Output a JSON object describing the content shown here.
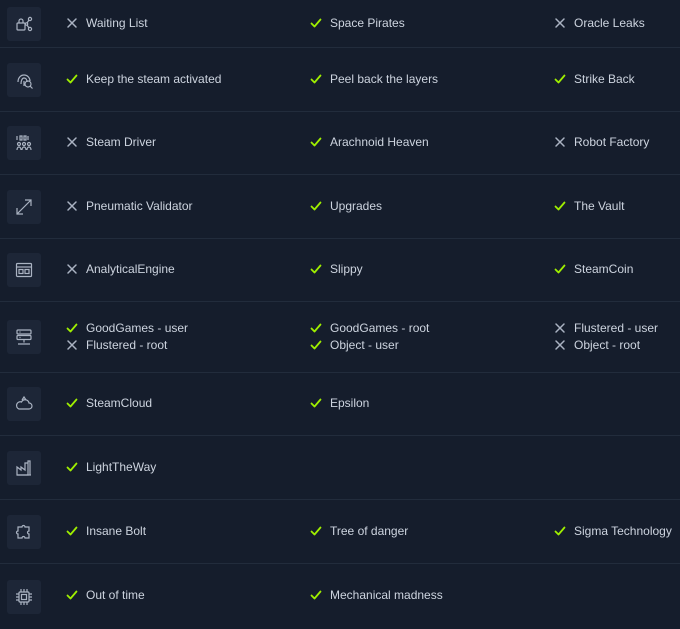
{
  "colors": {
    "background": "#151d2c",
    "icon_bg": "#1d2637",
    "check": "#9fef00",
    "cross": "#aab3c2",
    "divider": "#222c3c",
    "text": "#cdd4df"
  },
  "rows": [
    {
      "icon": "lock-share-icon",
      "columns": [
        [
          {
            "label": "Waiting List",
            "done": false
          }
        ],
        [
          {
            "label": "Space Pirates",
            "done": true
          }
        ],
        [
          {
            "label": "Oracle Leaks",
            "done": false
          }
        ]
      ]
    },
    {
      "icon": "fingerprint-search-icon",
      "columns": [
        [
          {
            "label": "Keep the steam activated",
            "done": true
          }
        ],
        [
          {
            "label": "Peel back the layers",
            "done": true
          }
        ],
        [
          {
            "label": "Strike Back",
            "done": true
          }
        ]
      ]
    },
    {
      "icon": "binary-code-icon",
      "columns": [
        [
          {
            "label": "Steam Driver",
            "done": false
          }
        ],
        [
          {
            "label": "Arachnoid Heaven",
            "done": true
          }
        ],
        [
          {
            "label": "Robot Factory",
            "done": false
          }
        ]
      ]
    },
    {
      "icon": "diagonal-arrows-icon",
      "columns": [
        [
          {
            "label": "Pneumatic Validator",
            "done": false
          }
        ],
        [
          {
            "label": "Upgrades",
            "done": true
          }
        ],
        [
          {
            "label": "The Vault",
            "done": true
          }
        ]
      ]
    },
    {
      "icon": "window-app-icon",
      "columns": [
        [
          {
            "label": "AnalyticalEngine",
            "done": false
          }
        ],
        [
          {
            "label": "Slippy",
            "done": true
          }
        ],
        [
          {
            "label": "SteamCoin",
            "done": true
          }
        ]
      ]
    },
    {
      "icon": "server-network-icon",
      "columns": [
        [
          {
            "label": "GoodGames - user",
            "done": true
          },
          {
            "label": "Flustered - root",
            "done": false
          }
        ],
        [
          {
            "label": "GoodGames - root",
            "done": true
          },
          {
            "label": "Object - user",
            "done": true
          }
        ],
        [
          {
            "label": "Flustered - user",
            "done": false
          },
          {
            "label": "Object - root",
            "done": false
          }
        ]
      ]
    },
    {
      "icon": "cloud-icon",
      "columns": [
        [
          {
            "label": "SteamCloud",
            "done": true
          }
        ],
        [
          {
            "label": "Epsilon",
            "done": true
          }
        ],
        []
      ]
    },
    {
      "icon": "factory-icon",
      "columns": [
        [
          {
            "label": "LightTheWay",
            "done": true
          }
        ],
        [],
        []
      ]
    },
    {
      "icon": "puzzle-icon",
      "columns": [
        [
          {
            "label": "Insane Bolt",
            "done": true
          }
        ],
        [
          {
            "label": "Tree of danger",
            "done": true
          }
        ],
        [
          {
            "label": "Sigma Technology",
            "done": true
          }
        ]
      ]
    },
    {
      "icon": "chip-icon",
      "columns": [
        [
          {
            "label": "Out of time",
            "done": true
          }
        ],
        [
          {
            "label": "Mechanical madness",
            "done": true
          }
        ],
        []
      ]
    }
  ]
}
